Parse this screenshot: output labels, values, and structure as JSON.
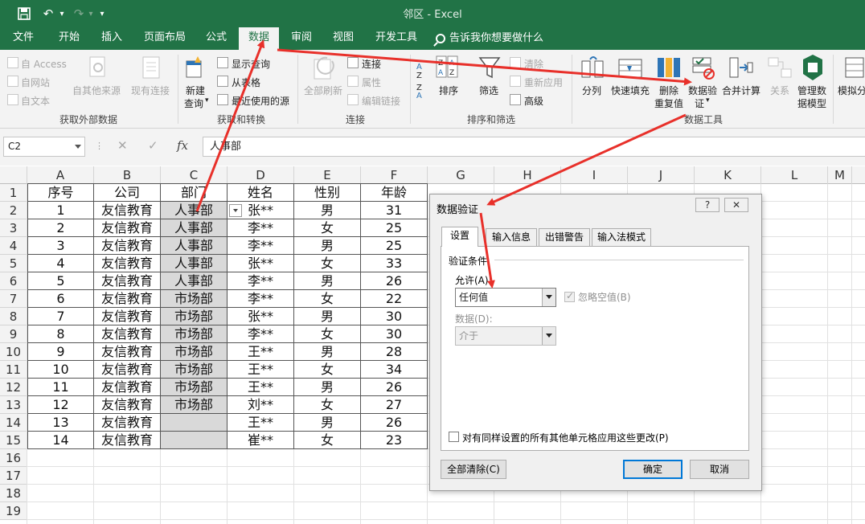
{
  "window": {
    "title": "邻区  -  Excel",
    "save_icon": "save-icon",
    "undo_glyph": "↶",
    "redo_glyph": "↷",
    "customize_glyph": "▾"
  },
  "menu": {
    "tabs": [
      "文件",
      "开始",
      "插入",
      "页面布局",
      "公式",
      "数据",
      "审阅",
      "视图",
      "开发工具"
    ],
    "active_index": 5,
    "tellme": "告诉我你想要做什么"
  },
  "ribbon": {
    "external": {
      "access": "自 Access",
      "web": "自网站",
      "text": "自文本",
      "other_sources": "自其他来源",
      "existing": "现有连接",
      "group_label": "获取外部数据"
    },
    "transform": {
      "new_query_line1": "新建",
      "new_query_line2": "查询",
      "show_query": "显示查询",
      "from_table": "从表格",
      "recent_sources": "最近使用的源",
      "group_label": "获取和转换"
    },
    "connections": {
      "refresh_all": "全部刷新",
      "connections": "连接",
      "properties": "属性",
      "edit_links": "编辑链接",
      "group_label": "连接"
    },
    "sort_filter": {
      "sort": "排序",
      "filter": "筛选",
      "clear": "清除",
      "reapply": "重新应用",
      "advanced": "高级",
      "group_label": "排序和筛选"
    },
    "data_tools": {
      "split": "分列",
      "flash_fill": "快速填充",
      "remove_dup_line1": "删除",
      "remove_dup_line2": "重复值",
      "validation_line1": "数据验",
      "validation_line2": "证",
      "consolidate": "合并计算",
      "relationships": "关系",
      "model_line1": "管理数",
      "model_line2": "据模型",
      "group_label": "数据工具"
    },
    "forecast": {
      "whatif_line1": "模拟分"
    }
  },
  "formula_bar": {
    "name_box": "C2",
    "cancel": "✕",
    "enter": "✓",
    "fx": "fx",
    "value": "人事部"
  },
  "grid": {
    "columns": [
      "A",
      "B",
      "C",
      "D",
      "E",
      "F",
      "G",
      "H",
      "I",
      "J",
      "K",
      "L",
      "M"
    ],
    "rows": [
      "1",
      "2",
      "3",
      "4",
      "5",
      "6",
      "7",
      "8",
      "9",
      "10",
      "11",
      "12",
      "13",
      "14",
      "15",
      "16",
      "17",
      "18",
      "19"
    ],
    "headers": [
      "序号",
      "公司",
      "部门",
      "姓名",
      "性别",
      "年龄"
    ],
    "data": [
      [
        "1",
        "友信教育",
        "人事部",
        "张**",
        "男",
        "31"
      ],
      [
        "2",
        "友信教育",
        "人事部",
        "李**",
        "女",
        "25"
      ],
      [
        "3",
        "友信教育",
        "人事部",
        "李**",
        "男",
        "25"
      ],
      [
        "4",
        "友信教育",
        "人事部",
        "张**",
        "女",
        "33"
      ],
      [
        "5",
        "友信教育",
        "人事部",
        "李**",
        "男",
        "26"
      ],
      [
        "6",
        "友信教育",
        "市场部",
        "李**",
        "女",
        "22"
      ],
      [
        "7",
        "友信教育",
        "市场部",
        "张**",
        "男",
        "30"
      ],
      [
        "8",
        "友信教育",
        "市场部",
        "李**",
        "女",
        "30"
      ],
      [
        "9",
        "友信教育",
        "市场部",
        "王**",
        "男",
        "28"
      ],
      [
        "10",
        "友信教育",
        "市场部",
        "王**",
        "女",
        "34"
      ],
      [
        "11",
        "友信教育",
        "市场部",
        "王**",
        "男",
        "26"
      ],
      [
        "12",
        "友信教育",
        "市场部",
        "刘**",
        "女",
        "27"
      ],
      [
        "13",
        "友信教育",
        "",
        "王**",
        "男",
        "26"
      ],
      [
        "14",
        "友信教育",
        "",
        "崔**",
        "女",
        "23"
      ]
    ]
  },
  "dialog": {
    "title": "数据验证",
    "help": "?",
    "close": "✕",
    "tabs": [
      "设置",
      "输入信息",
      "出错警告",
      "输入法模式"
    ],
    "criteria_label": "验证条件",
    "allow_label": "允许(A):",
    "allow_value": "任何值",
    "ignore_blank": "忽略空值(B)",
    "data_label": "数据(D):",
    "data_value": "介于",
    "apply_all": "对有同样设置的所有其他单元格应用这些更改(P)",
    "clear_all": "全部清除(C)",
    "ok": "确定",
    "cancel": "取消"
  },
  "colors": {
    "excel_green": "#217346",
    "annotation_red": "#e8302a",
    "selected_gray": "#d9d9d9"
  }
}
